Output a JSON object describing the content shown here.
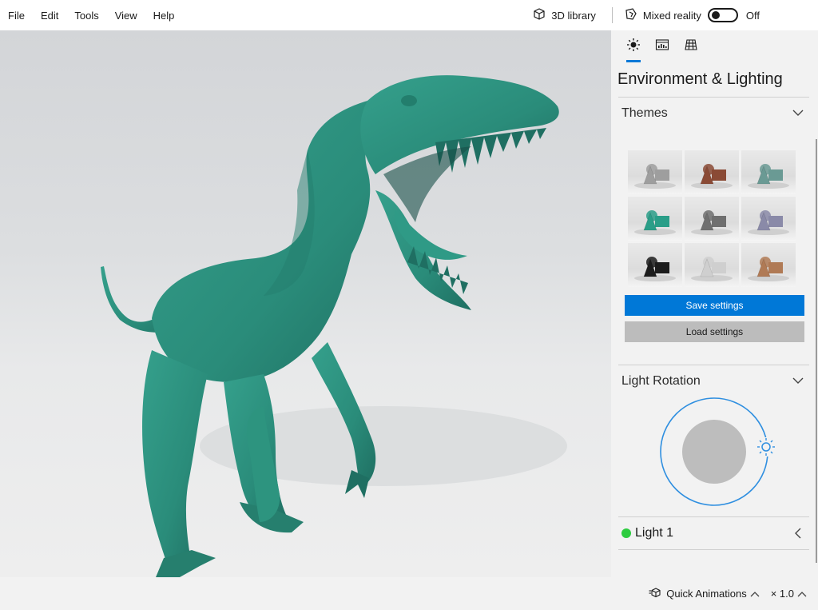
{
  "menu": [
    "File",
    "Edit",
    "Tools",
    "View",
    "Help"
  ],
  "toolbar": {
    "library_label": "3D library",
    "library_icon": "cube-icon",
    "mixed_reality_label": "Mixed reality",
    "mixed_reality_icon": "mixed-reality-icon",
    "mixed_reality_state": "Off"
  },
  "viewport": {
    "model": "green raptor dinosaur 3D model",
    "model_color": "#2a8c7a"
  },
  "panel": {
    "tabs": [
      {
        "icon": "sun-icon",
        "active": true
      },
      {
        "icon": "stats-icon",
        "active": false
      },
      {
        "icon": "grid-icon",
        "active": false
      }
    ],
    "title": "Environment & Lighting",
    "themes": {
      "label": "Themes",
      "tiles": [
        {
          "color": "#9e9e9e"
        },
        {
          "color": "#8a4a35"
        },
        {
          "color": "#6a9a94"
        },
        {
          "color": "#2a9e88"
        },
        {
          "color": "#6f6f6f"
        },
        {
          "color": "#8a8aa8"
        },
        {
          "color": "#1c1c1c"
        },
        {
          "color": "#cfcfcf"
        },
        {
          "color": "#b07a55"
        }
      ]
    },
    "save_label": "Save settings",
    "load_label": "Load settings",
    "light_rotation_label": "Light Rotation",
    "light1_label": "Light 1",
    "accent": "#0078d7",
    "light1_color": "#2ecc40"
  },
  "status": {
    "animations_label": "Quick Animations",
    "speed_label": "× 1.0"
  }
}
